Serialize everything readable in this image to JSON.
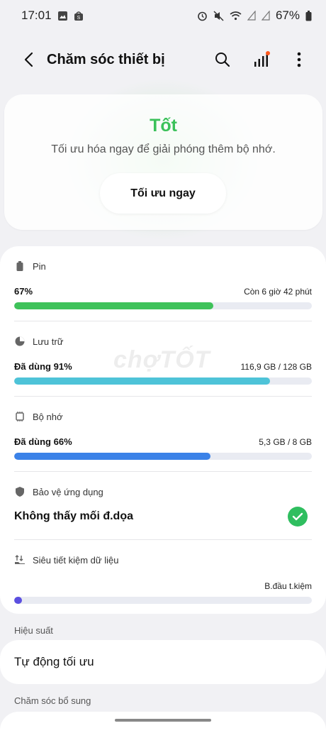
{
  "status_bar": {
    "time": "17:01",
    "battery": "67%"
  },
  "app_bar": {
    "title": "Chăm sóc thiết bị"
  },
  "hero": {
    "status": "Tốt",
    "message": "Tối ưu hóa ngay để giải phóng thêm bộ nhớ.",
    "button": "Tối ưu ngay"
  },
  "battery": {
    "label": "Pin",
    "value": "67%",
    "remaining": "Còn 6 giờ 42 phút",
    "percent": 67,
    "color": "#3fc25a"
  },
  "storage": {
    "label": "Lưu trữ",
    "value": "Đã dùng 91%",
    "detail": "116,9 GB / 128 GB",
    "percent": 86,
    "color": "#4ec3d8"
  },
  "memory": {
    "label": "Bộ nhớ",
    "value": "Đã dùng 66%",
    "detail": "5,3 GB / 8 GB",
    "percent": 66,
    "color": "#3b82e8"
  },
  "app_protection": {
    "label": "Bảo vệ ứng dụng",
    "status": "Không thấy mối đ.dọa"
  },
  "data_saver": {
    "label": "Siêu tiết kiệm dữ liệu",
    "status": "B.đầu t.kiệm",
    "percent": 2.5,
    "color": "#5b4fe0"
  },
  "watermark": "chợTỐT",
  "performance": {
    "title": "Hiệu suất",
    "item": "Tự động tối ưu"
  },
  "extra": {
    "title": "Chăm sóc bổ sung"
  }
}
